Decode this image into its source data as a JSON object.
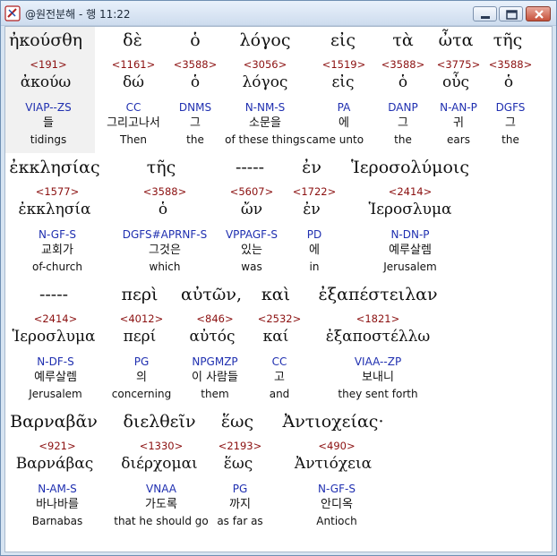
{
  "window": {
    "title": "@원전분해 - 행 11:22"
  },
  "rows": [
    {
      "words": [
        {
          "greek": "ἠκούσθη",
          "strong": "<191>",
          "lemma": "ἀκούω",
          "morph": "VIAP--ZS",
          "korean": "들",
          "english": "tidings"
        },
        {
          "greek": "δὲ",
          "strong": "<1161>",
          "lemma": "δώ",
          "morph": "CC",
          "korean": "그리고나서",
          "english": "Then"
        },
        {
          "greek": "ὁ",
          "strong": "<3588>",
          "lemma": "ὁ",
          "morph": "DNMS",
          "korean": "그",
          "english": "the"
        },
        {
          "greek": "λόγος",
          "strong": "<3056>",
          "lemma": "λόγος",
          "morph": "N-NM-S",
          "korean": "소문을",
          "english": "of these things"
        },
        {
          "greek": "εἰς",
          "strong": "<1519>",
          "lemma": "εἰς",
          "morph": "PA",
          "korean": "에",
          "english": "came unto"
        },
        {
          "greek": "τὰ",
          "strong": "<3588>",
          "lemma": "ὁ",
          "morph": "DANP",
          "korean": "그",
          "english": "the"
        },
        {
          "greek": "ὦτα",
          "strong": "<3775>",
          "lemma": "οὖς",
          "morph": "N-AN-P",
          "korean": "귀",
          "english": "ears"
        },
        {
          "greek": "τῆς",
          "strong": "<3588>",
          "lemma": "ὁ",
          "morph": "DGFS",
          "korean": "그",
          "english": "the"
        }
      ]
    },
    {
      "words": [
        {
          "greek": "ἐκκλησίας",
          "strong": "<1577>",
          "lemma": "ἐκκλησία",
          "morph": "N-GF-S",
          "korean": "교회가",
          "english": "of-church"
        },
        {
          "greek": "τῆς",
          "strong": "<3588>",
          "lemma": "ὁ",
          "morph": "DGFS#APRNF-S",
          "korean": "그것은",
          "english": "which"
        },
        {
          "greek": "-----",
          "strong": "<5607>",
          "lemma": "ὤν",
          "morph": "VPPAGF-S",
          "korean": "있는",
          "english": "was"
        },
        {
          "greek": "ἐν",
          "strong": "<1722>",
          "lemma": "ἐν",
          "morph": "PD",
          "korean": "에",
          "english": "in"
        },
        {
          "greek": "Ἱεροσολύμοις",
          "strong": "<2414>",
          "lemma": "Ἱεροσλυμα",
          "morph": "N-DN-P",
          "korean": "예루살렘",
          "english": "Jerusalem"
        }
      ]
    },
    {
      "words": [
        {
          "greek": "-----",
          "strong": "<2414>",
          "lemma": "Ἱεροσλυμα",
          "morph": "N-DF-S",
          "korean": "예루살렘",
          "english": "Jerusalem"
        },
        {
          "greek": "περὶ",
          "strong": "<4012>",
          "lemma": "περί",
          "morph": "PG",
          "korean": "의",
          "english": "concerning"
        },
        {
          "greek": "αὐτῶν,",
          "strong": "<846>",
          "lemma": "αὐτός",
          "morph": "NPGMZP",
          "korean": "이 사람들",
          "english": "them"
        },
        {
          "greek": "καὶ",
          "strong": "<2532>",
          "lemma": "καί",
          "morph": "CC",
          "korean": "고",
          "english": "and"
        },
        {
          "greek": "ἐξαπέστειλαν",
          "strong": "<1821>",
          "lemma": "ἐξαποστέλλω",
          "morph": "VIAA--ZP",
          "korean": "보내니",
          "english": "they sent forth"
        }
      ]
    },
    {
      "words": [
        {
          "greek": "Βαρναβᾶν",
          "strong": "<921>",
          "lemma": "Βαρνάβας",
          "morph": "N-AM-S",
          "korean": "바나바를",
          "english": "Barnabas"
        },
        {
          "greek": "διελθεῖν",
          "strong": "<1330>",
          "lemma": "διέρχομαι",
          "morph": "VNAA",
          "korean": "가도록",
          "english": "that he should go"
        },
        {
          "greek": "ἕως",
          "strong": "<2193>",
          "lemma": "ἕως",
          "morph": "PG",
          "korean": "까지",
          "english": "as far as"
        },
        {
          "greek": "Ἀντιοχείας·",
          "strong": "<490>",
          "lemma": "Ἀντιόχεια",
          "morph": "N-GF-S",
          "korean": "안디옥",
          "english": "Antioch"
        }
      ]
    }
  ]
}
